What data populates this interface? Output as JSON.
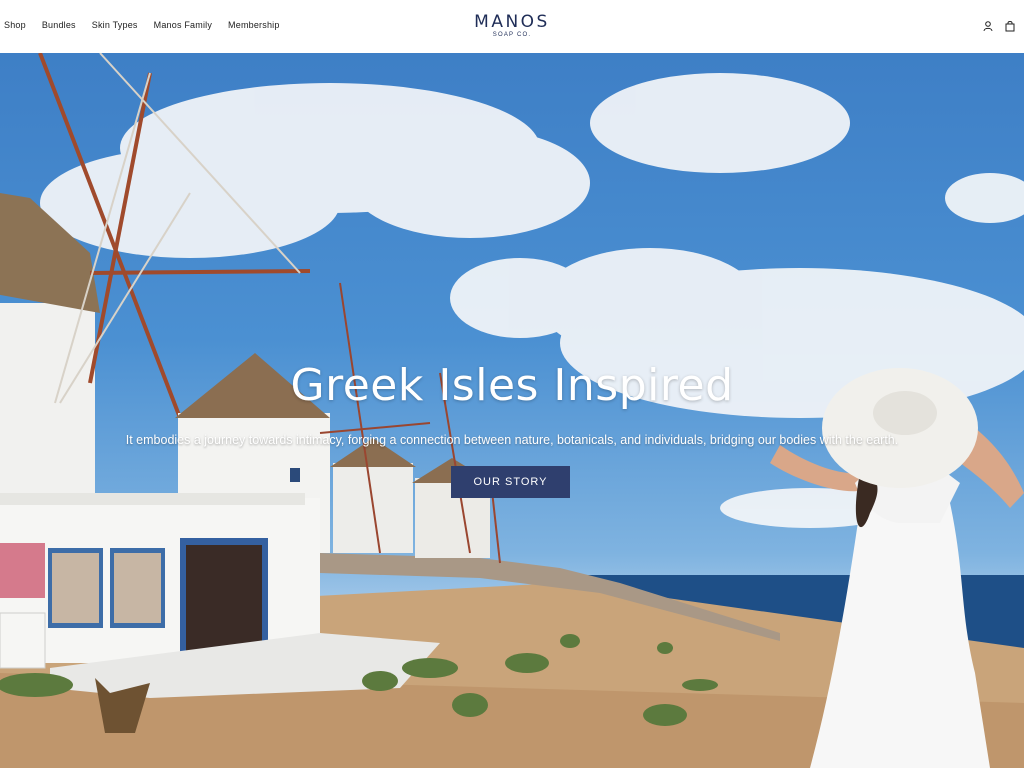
{
  "nav": {
    "items": [
      {
        "label": "Shop"
      },
      {
        "label": "Bundles"
      },
      {
        "label": "Skin Types"
      },
      {
        "label": "Manos Family"
      },
      {
        "label": "Membership"
      }
    ]
  },
  "brand": {
    "name": "MANOS",
    "subtitle": "SOAP CO."
  },
  "header_icons": [
    "user-icon",
    "bag-icon"
  ],
  "hero": {
    "title": "Greek Isles Inspired",
    "subtitle": "It embodies a journey towards intimacy, forging a connection between nature, botanicals, and individuals, bridging our bodies with the earth.",
    "cta_label": "OUR STORY"
  },
  "colors": {
    "brand_navy": "#1f2d57",
    "cta_bg": "#2f3f6e"
  }
}
